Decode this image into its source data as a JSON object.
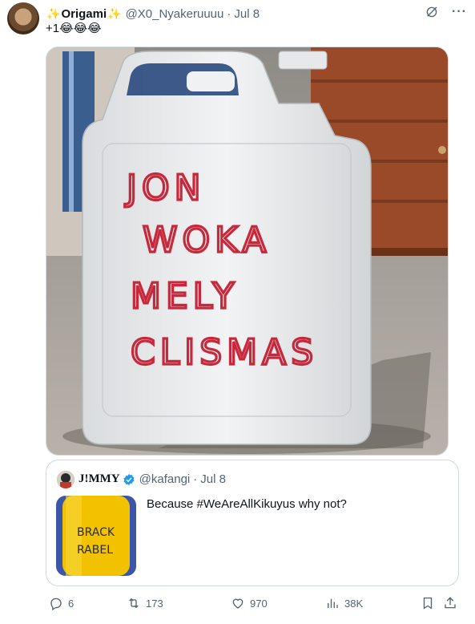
{
  "tweet": {
    "author_name": "Origami",
    "author_handle": "@X0_Nyakeruuuu",
    "separator": "·",
    "date": "Jul 8",
    "text": "+1😂😂😂",
    "sparkle_emoji": "✨",
    "photo_text": [
      "JON",
      "WOKA",
      "MELY",
      "CLISMAS"
    ]
  },
  "quote": {
    "author_name": "J!MMY",
    "author_handle": "@kafangi",
    "separator": "·",
    "date": "Jul 8",
    "text": "Because #WeAreAllKikuyus why not?",
    "thumb_text": [
      "BRACK",
      "RABEL"
    ]
  },
  "actions": {
    "replies": "6",
    "reposts": "173",
    "likes": "970",
    "views": "38K"
  },
  "colors": {
    "text": "#0f1419",
    "secondary": "#536471",
    "border": "#cfd9de",
    "verified": "#1d9bf0",
    "marker_red": "#c8283c"
  },
  "icons": {
    "more": "more-icon",
    "grok": "grok-icon",
    "reply": "reply-icon",
    "repost": "repost-icon",
    "like": "like-icon",
    "views": "views-icon",
    "bookmark": "bookmark-icon",
    "share": "share-icon"
  }
}
